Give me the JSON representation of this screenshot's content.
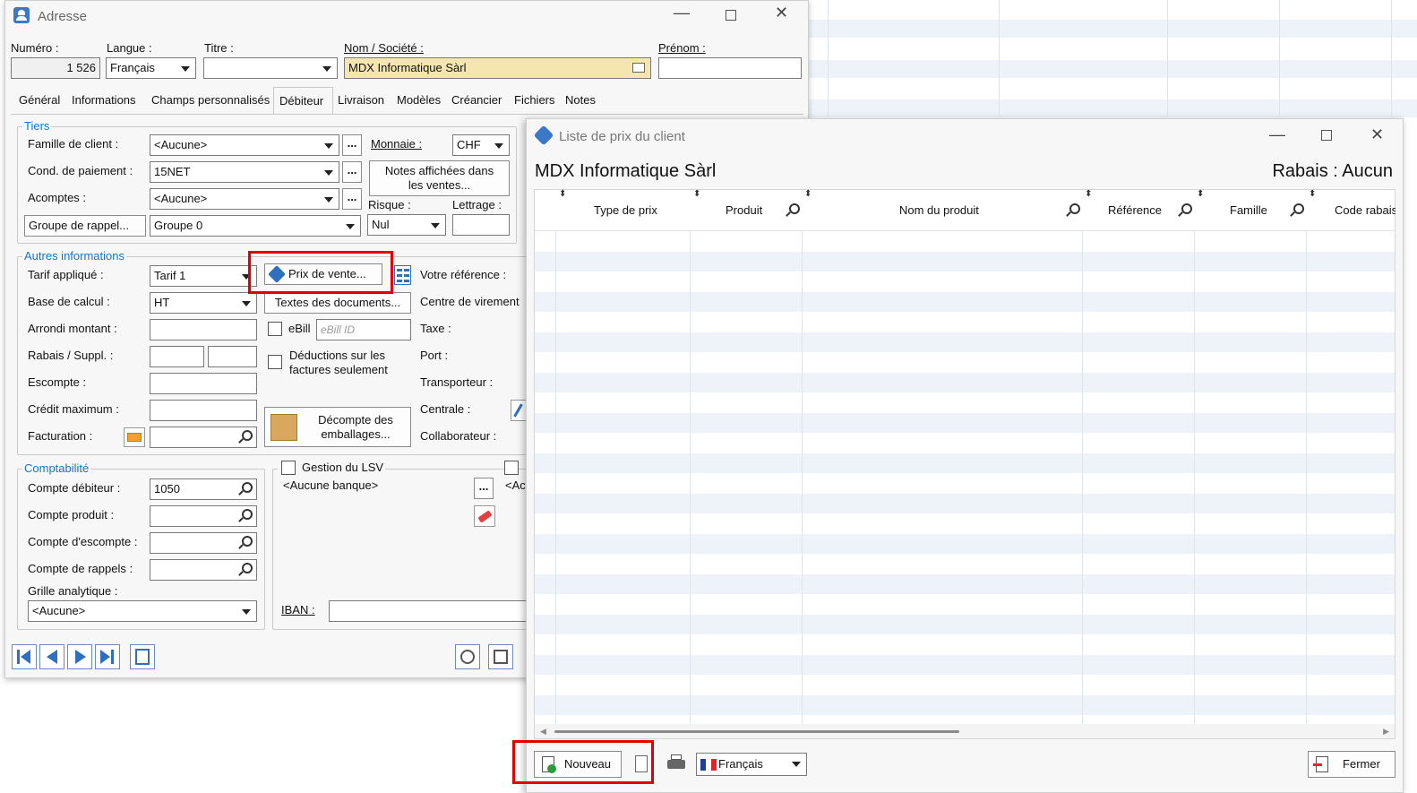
{
  "adresse_window": {
    "title": "Adresse",
    "top_fields": {
      "numero": {
        "label": "Numéro :",
        "value": "1 526"
      },
      "langue": {
        "label": "Langue :",
        "value": "Français"
      },
      "titre": {
        "label": "Titre :",
        "value": ""
      },
      "nom": {
        "label": "Nom / Société :",
        "value": "MDX Informatique Sàrl"
      },
      "prenom": {
        "label": "Prénom :",
        "value": ""
      }
    },
    "tabs": [
      "Général",
      "Informations",
      "Champs personnalisés",
      "Débiteur",
      "Livraison",
      "Modèles",
      "Créancier",
      "Fichiers",
      "Notes"
    ],
    "active_tab": "Débiteur",
    "tiers": {
      "title": "Tiers",
      "famille_label": "Famille de client :",
      "famille_value": "<Aucune>",
      "cond_label": "Cond. de paiement :",
      "cond_value": "15NET",
      "acomptes_label": "Acomptes :",
      "acomptes_value": "<Aucune>",
      "rappel_button": "Groupe de rappel...",
      "rappel_value": "Groupe 0",
      "monnaie_label": "Monnaie :",
      "monnaie_value": "CHF",
      "notes_button_line1": "Notes affichées dans",
      "notes_button_line2": "les ventes...",
      "risque_label": "Risque :",
      "risque_value": "Nul",
      "lettrage_label": "Lettrage :",
      "lettrage_value": ""
    },
    "autres": {
      "title": "Autres informations",
      "tarif_label": "Tarif appliqué :",
      "tarif_value": "Tarif 1",
      "base_label": "Base de calcul :",
      "base_value": "HT",
      "arrondi_label": "Arrondi montant :",
      "rabais_label": "Rabais / Suppl. :",
      "escompte_label": "Escompte :",
      "credit_label": "Crédit maximum :",
      "facturation_label": "Facturation :",
      "prix_button": "Prix de vente...",
      "textes_button": "Textes des documents...",
      "ebill_label": "eBill",
      "ebill_placeholder": "eBill ID",
      "deductions_line1": "Déductions sur les",
      "deductions_line2": "factures seulement",
      "decompte_line1": "Décompte des",
      "decompte_line2": "emballages...",
      "votre_ref_label": "Votre référence :",
      "centre_label": "Centre de virement",
      "taxe_label": "Taxe :",
      "port_label": "Port :",
      "transporteur_label": "Transporteur :",
      "centrale_label": "Centrale :",
      "collaborateur_label": "Collaborateur :"
    },
    "compta": {
      "title": "Comptabilité",
      "debiteur_label": "Compte débiteur :",
      "debiteur_value": "1050",
      "produit_label": "Compte produit :",
      "escompte_label": "Compte d'escompte :",
      "rappels_label": "Compte de rappels :",
      "grille_label": "Grille analytique :",
      "grille_value": "<Aucune>"
    },
    "lsv": {
      "title": "Gestion du LSV",
      "banque_value": "<Aucune banque>",
      "iban_label": "IBAN :",
      "right_value": "<Ac"
    }
  },
  "prix_window": {
    "title": "Liste de prix du client",
    "client_name": "MDX Informatique Sàrl",
    "rabais": "Rabais : Aucun",
    "columns": [
      "Type de prix",
      "Produit",
      "Nom du produit",
      "Référence",
      "Famille",
      "Code rabais"
    ],
    "nouveau_button": "Nouveau",
    "language_value": "Français",
    "fermer_button": "Fermer"
  },
  "colors": {
    "accent_blue": "#1a73c7",
    "highlight_field": "#f5e6b0",
    "red_annotation": "#e00000",
    "row_stripe": "#eef3fa"
  }
}
